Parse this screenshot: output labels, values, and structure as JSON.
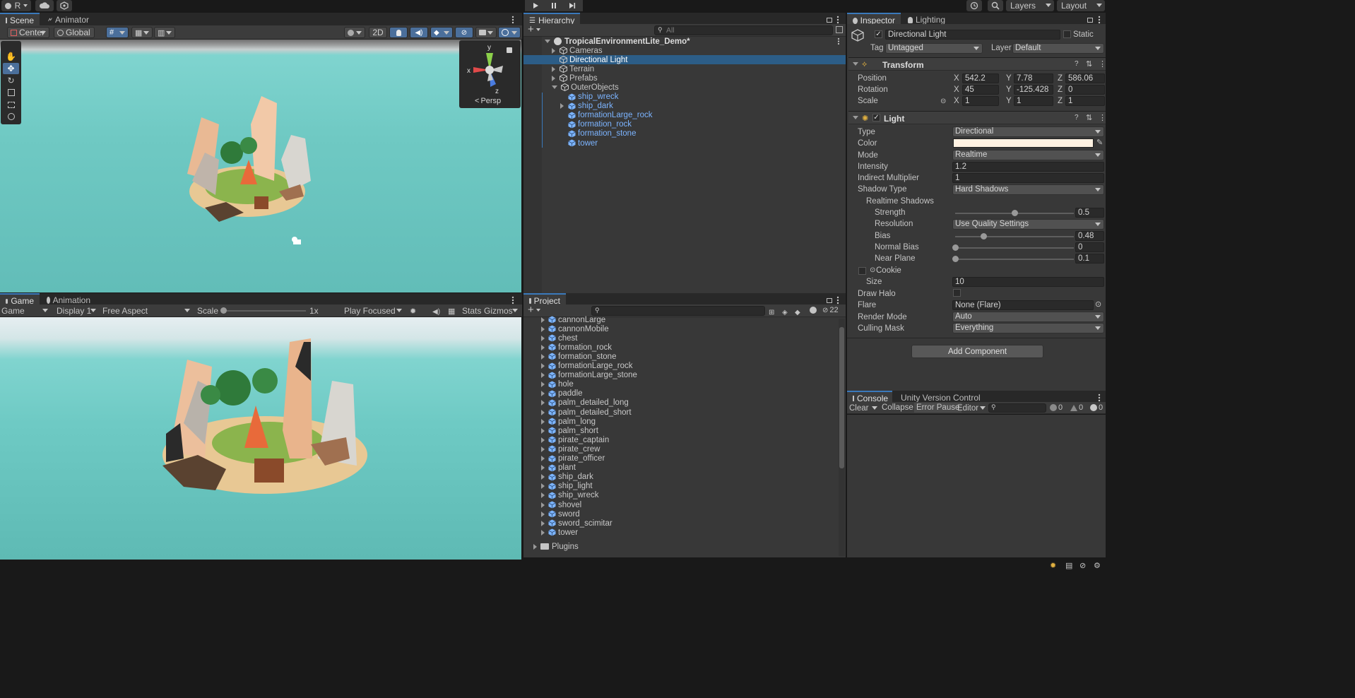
{
  "top_toolbar": {
    "account_label": "R",
    "play_controls": [
      "play",
      "pause",
      "step"
    ],
    "layers_label": "Layers",
    "layout_label": "Layout"
  },
  "scene_panel": {
    "tabs": [
      "Scene",
      "Animator"
    ],
    "pivot_label": "Center",
    "space_label": "Global",
    "mode_2d_label": "2D",
    "persp_label": "Persp",
    "gizmo_axes": {
      "x": "x",
      "y": "y",
      "z": "z"
    }
  },
  "game_panel": {
    "tabs": [
      "Game",
      "Animation"
    ],
    "view_dropdown": "Game",
    "display_dropdown": "Display 1",
    "aspect_dropdown": "Free Aspect",
    "scale_label": "Scale",
    "scale_value": "1x",
    "scale_level": 0,
    "play_focus_dropdown": "Play Focused",
    "stats_label": "Stats",
    "gizmos_label": "Gizmos"
  },
  "hierarchy": {
    "tab": "Hierarchy",
    "search_placeholder": "All",
    "root": "TropicalEnvironmentLite_Demo*",
    "items": [
      {
        "label": "Cameras",
        "indent": 1,
        "expand": "collapsed",
        "prefab": false,
        "selected": false
      },
      {
        "label": "Directional Light",
        "indent": 1,
        "expand": "none",
        "prefab": false,
        "selected": true
      },
      {
        "label": "Terrain",
        "indent": 1,
        "expand": "collapsed",
        "prefab": false,
        "selected": false
      },
      {
        "label": "Prefabs",
        "indent": 1,
        "expand": "collapsed",
        "prefab": false,
        "selected": false
      },
      {
        "label": "OuterObjects",
        "indent": 1,
        "expand": "expanded",
        "prefab": false,
        "selected": false
      },
      {
        "label": "ship_wreck",
        "indent": 2,
        "expand": "none",
        "prefab": true,
        "selected": false
      },
      {
        "label": "ship_dark",
        "indent": 2,
        "expand": "collapsed",
        "prefab": true,
        "selected": false
      },
      {
        "label": "formationLarge_rock",
        "indent": 2,
        "expand": "none",
        "prefab": true,
        "selected": false
      },
      {
        "label": "formation_rock",
        "indent": 2,
        "expand": "none",
        "prefab": true,
        "selected": false
      },
      {
        "label": "formation_stone",
        "indent": 2,
        "expand": "none",
        "prefab": true,
        "selected": false
      },
      {
        "label": "tower",
        "indent": 2,
        "expand": "none",
        "prefab": true,
        "selected": false
      }
    ]
  },
  "project": {
    "tab": "Project",
    "hidden_count": "22",
    "items": [
      "cannonLarge",
      "cannonMobile",
      "chest",
      "formation_rock",
      "formation_stone",
      "formationLarge_rock",
      "formationLarge_stone",
      "hole",
      "paddle",
      "palm_detailed_long",
      "palm_detailed_short",
      "palm_long",
      "palm_short",
      "pirate_captain",
      "pirate_crew",
      "pirate_officer",
      "plant",
      "ship_dark",
      "ship_light",
      "ship_wreck",
      "shovel",
      "sword",
      "sword_scimitar",
      "tower"
    ],
    "folder": "Plugins"
  },
  "inspector": {
    "tabs": [
      "Inspector",
      "Lighting"
    ],
    "object_name": "Directional Light",
    "static_label": "Static",
    "tag_label": "Tag",
    "tag_value": "Untagged",
    "layer_label": "Layer",
    "layer_value": "Default",
    "transform": {
      "title": "Transform",
      "position_label": "Position",
      "rotation_label": "Rotation",
      "scale_label": "Scale",
      "position": {
        "x": "542.2",
        "y": "7.78",
        "z": "586.06"
      },
      "rotation": {
        "x": "45",
        "y": "-125.428",
        "z": "0"
      },
      "scale": {
        "x": "1",
        "y": "1",
        "z": "1"
      }
    },
    "light": {
      "title": "Light",
      "type_label": "Type",
      "type_value": "Directional",
      "color_label": "Color",
      "color_value": "#FFF2E2",
      "mode_label": "Mode",
      "mode_value": "Realtime",
      "intensity_label": "Intensity",
      "intensity_value": "1.2",
      "indirect_label": "Indirect Multiplier",
      "indirect_value": "1",
      "shadow_type_label": "Shadow Type",
      "shadow_type_value": "Hard Shadows",
      "realtime_shadows_label": "Realtime Shadows",
      "strength_label": "Strength",
      "strength_value": "0.5",
      "strength_level": 0.5,
      "resolution_label": "Resolution",
      "resolution_value": "Use Quality Settings",
      "bias_label": "Bias",
      "bias_value": "0.48",
      "bias_level": 0.24,
      "normal_bias_label": "Normal Bias",
      "normal_bias_value": "0",
      "normal_bias_level": 0,
      "near_plane_label": "Near Plane",
      "near_plane_value": "0.1",
      "near_plane_level": 0,
      "cookie_label": "Cookie",
      "size_label": "Size",
      "size_value": "10",
      "draw_halo_label": "Draw Halo",
      "flare_label": "Flare",
      "flare_value": "None (Flare)",
      "render_mode_label": "Render Mode",
      "render_mode_value": "Auto",
      "culling_mask_label": "Culling Mask",
      "culling_mask_value": "Everything"
    },
    "add_component_label": "Add Component"
  },
  "console": {
    "tabs": [
      "Console",
      "Unity Version Control"
    ],
    "clear_label": "Clear",
    "collapse_label": "Collapse",
    "error_pause_label": "Error Pause",
    "editor_label": "Editor",
    "log_count": "0",
    "warn_count": "0",
    "error_count": "0"
  },
  "colors": {
    "selection": "#2c5d87",
    "prefab_text": "#7cb4ff",
    "accent": "#3a79bb"
  }
}
